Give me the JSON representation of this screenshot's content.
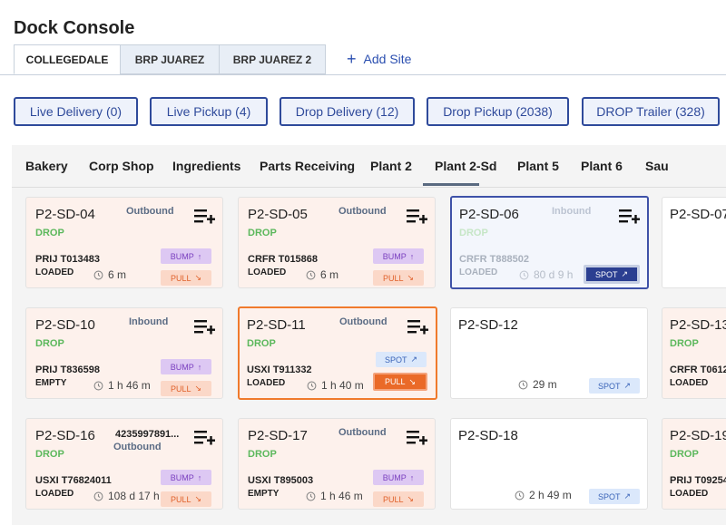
{
  "app": {
    "title": "Dock Console"
  },
  "site_tabs": [
    {
      "label": "COLLEGEDALE",
      "active": true
    },
    {
      "label": "BRP JUAREZ",
      "active": false
    },
    {
      "label": "BRP JUAREZ 2",
      "active": false
    }
  ],
  "add_site_label": "Add Site",
  "filters": [
    {
      "label": "Live Delivery (0)"
    },
    {
      "label": "Live Pickup (4)"
    },
    {
      "label": "Drop Delivery (12)"
    },
    {
      "label": "Drop Pickup (2038)"
    },
    {
      "label": "DROP Trailer (328)"
    }
  ],
  "category_tabs": [
    {
      "label": "Bakery"
    },
    {
      "label": "Corp Shop"
    },
    {
      "label": "Ingredients"
    },
    {
      "label": "Parts Receiving"
    },
    {
      "label": "Plant 2"
    },
    {
      "label": "Plant 2-Sd",
      "active": true
    },
    {
      "label": "Plant 5"
    },
    {
      "label": "Plant 6"
    },
    {
      "label": "Sau"
    }
  ],
  "cards": {
    "c04": {
      "dock": "P2-SD-04",
      "direction": "Outbound",
      "type": "DROP",
      "trailer": "PRIJ T013483",
      "status": "LOADED",
      "time": "6 m",
      "bump": "BUMP",
      "pull": "PULL"
    },
    "c05": {
      "dock": "P2-SD-05",
      "direction": "Outbound",
      "type": "DROP",
      "trailer": "CRFR T015868",
      "status": "LOADED",
      "time": "6 m",
      "bump": "BUMP",
      "pull": "PULL"
    },
    "c06": {
      "dock": "P2-SD-06",
      "direction": "Inbound",
      "type": "DROP",
      "trailer": "CRFR T888502",
      "status": "LOADED",
      "time": "80 d 9 h",
      "spot": "SPOT"
    },
    "c07": {
      "dock": "P2-SD-07"
    },
    "c10": {
      "dock": "P2-SD-10",
      "direction": "Inbound",
      "type": "DROP",
      "trailer": "PRIJ T836598",
      "status": "EMPTY",
      "time": "1 h 46 m",
      "bump": "BUMP",
      "pull": "PULL"
    },
    "c11": {
      "dock": "P2-SD-11",
      "direction": "Outbound",
      "type": "DROP",
      "trailer": "USXI T911332",
      "status": "LOADED",
      "time": "1 h 40 m",
      "spot": "SPOT",
      "pull": "PULL"
    },
    "c12": {
      "dock": "P2-SD-12",
      "time": "29 m",
      "spot": "SPOT"
    },
    "c13": {
      "dock": "P2-SD-13",
      "type": "DROP",
      "trailer": "CRFR T0612",
      "status": "LOADED"
    },
    "c16": {
      "dock": "P2-SD-16",
      "ref": "4235997891...",
      "direction": "Outbound",
      "type": "DROP",
      "trailer": "USXI T76824011",
      "status": "LOADED",
      "time": "108 d 17 h",
      "bump": "BUMP",
      "pull": "PULL"
    },
    "c17": {
      "dock": "P2-SD-17",
      "direction": "Outbound",
      "type": "DROP",
      "trailer": "USXI T895003",
      "status": "EMPTY",
      "time": "1 h 46 m",
      "bump": "BUMP",
      "pull": "PULL"
    },
    "c18": {
      "dock": "P2-SD-18",
      "time": "2 h 49 m",
      "spot": "SPOT"
    },
    "c19": {
      "dock": "P2-SD-19",
      "type": "DROP",
      "trailer": "PRIJ T09254",
      "status": "LOADED"
    }
  },
  "icons": {
    "add": "add-to-queue-icon",
    "clock": "timer-icon",
    "arrow_up": "arrow-up-icon",
    "arrow_diag": "arrow-diagonal-icon"
  },
  "colors": {
    "accent": "#2f4a9b",
    "drop": "#5cb85c",
    "bump": "#7a3fbf",
    "pull": "#e0602a",
    "spot": "#3b64b8"
  }
}
